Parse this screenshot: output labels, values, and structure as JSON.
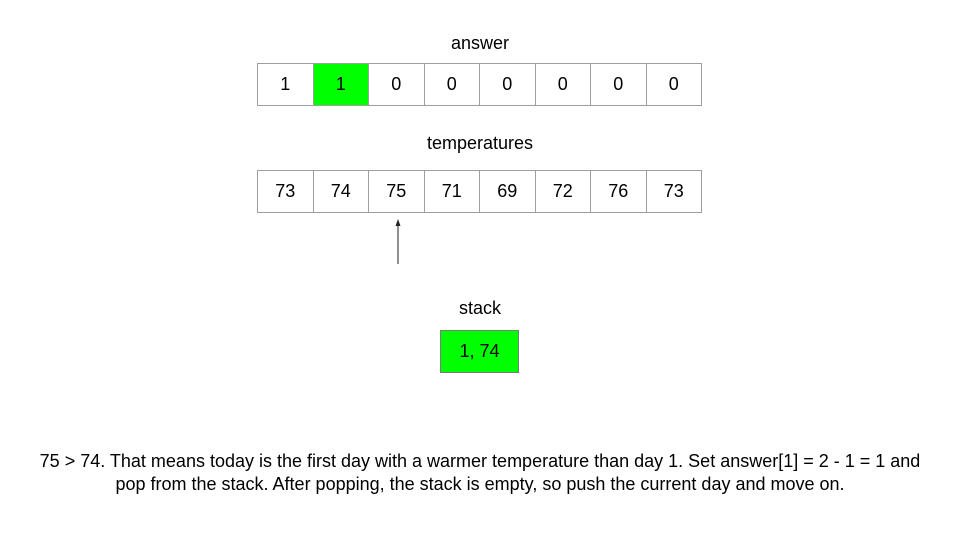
{
  "answer": {
    "label": "answer",
    "cells": [
      "1",
      "1",
      "0",
      "0",
      "0",
      "0",
      "0",
      "0"
    ],
    "highlight_index": 1
  },
  "temperatures": {
    "label": "temperatures",
    "cells": [
      "73",
      "74",
      "75",
      "71",
      "69",
      "72",
      "76",
      "73"
    ],
    "pointer_index": 2
  },
  "stack": {
    "label": "stack",
    "items": [
      "1, 74"
    ]
  },
  "caption": {
    "line1": "75 > 74. That means today is the first day with a warmer temperature than day 1. Set answer[1] = 2 - 1 = 1 and",
    "line2": "pop from the stack. After popping, the stack is empty, so push the current day and move on."
  },
  "colors": {
    "highlight": "#00ff00",
    "border": "#9e9e9e"
  }
}
